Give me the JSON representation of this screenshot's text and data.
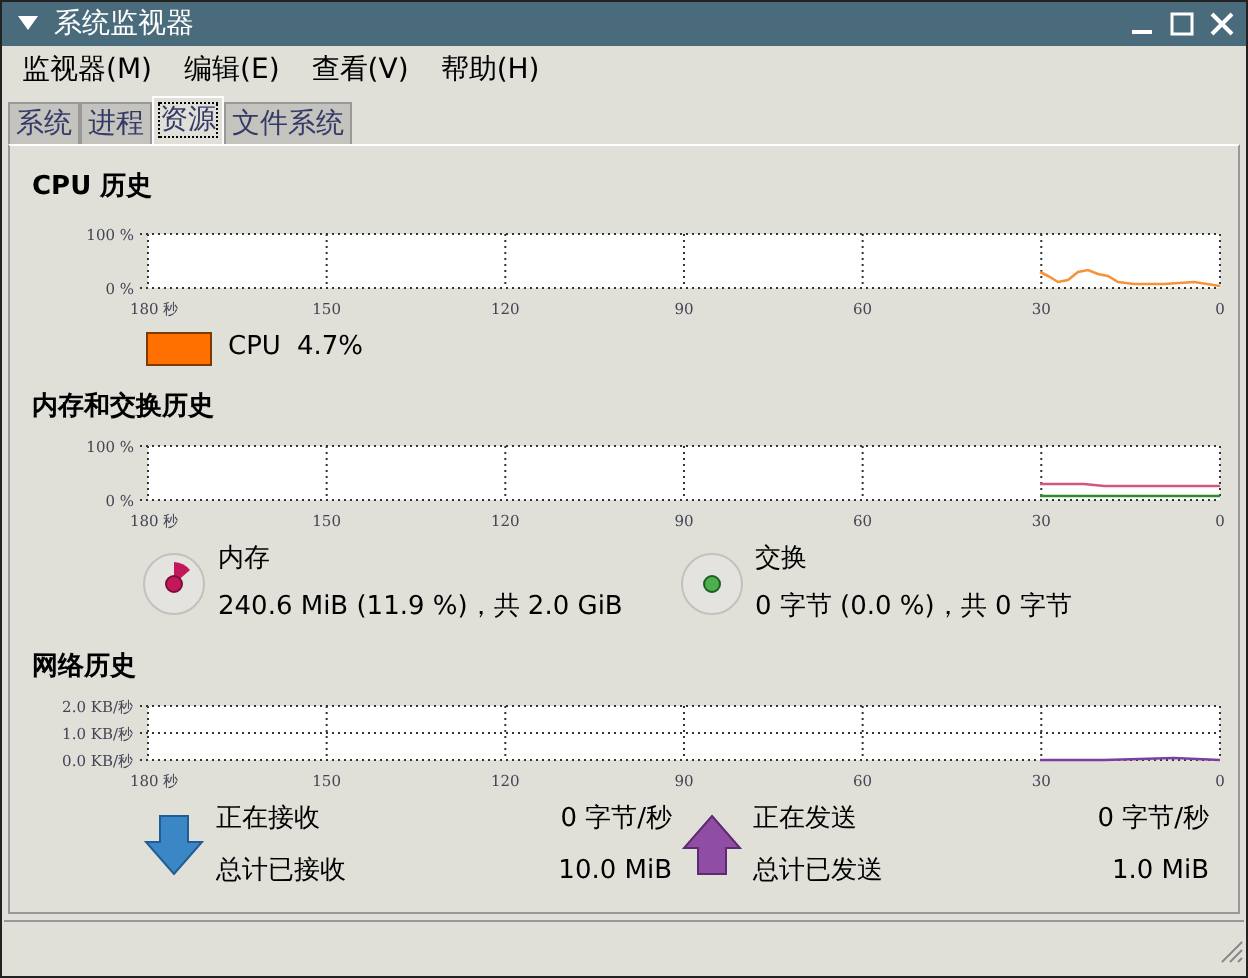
{
  "window": {
    "title": "系统监视器"
  },
  "menu": [
    "监视器(M)",
    "编辑(E)",
    "查看(V)",
    "帮助(H)"
  ],
  "tabs": [
    {
      "label": "系统",
      "selected": false
    },
    {
      "label": "进程",
      "selected": false
    },
    {
      "label": "资源",
      "selected": true
    },
    {
      "label": "文件系统",
      "selected": false
    }
  ],
  "cpu": {
    "title": "CPU 历史",
    "y_labels": [
      "100 %",
      "0 %"
    ],
    "x_labels": [
      "180 秒",
      "150",
      "120",
      "90",
      "60",
      "30",
      "0"
    ],
    "legend": [
      {
        "label": "CPU",
        "value": "4.7%",
        "color": "#ff7000"
      }
    ]
  },
  "memory": {
    "title": "内存和交换历史",
    "y_labels": [
      "100 %",
      "0 %"
    ],
    "x_labels": [
      "180 秒",
      "150",
      "120",
      "90",
      "60",
      "30",
      "0"
    ],
    "items": [
      {
        "kind": "memory",
        "label": "内存",
        "value": "240.6 MiB (11.9 %)，共 2.0 GiB",
        "color": "#c2185b"
      },
      {
        "kind": "swap",
        "label": "交换",
        "value": "0 字节 (0.0 %)，共 0 字节",
        "color": "#4caf50"
      }
    ]
  },
  "network": {
    "title": "网络历史",
    "y_labels": [
      "2.0 KB/秒",
      "1.0 KB/秒",
      "0.0 KB/秒"
    ],
    "x_labels": [
      "180 秒",
      "150",
      "120",
      "90",
      "60",
      "30",
      "0"
    ],
    "items": [
      {
        "kind": "receive",
        "rate_label": "正在接收",
        "rate": "0 字节/秒",
        "total_label": "总计已接收",
        "total": "10.0 MiB"
      },
      {
        "kind": "send",
        "rate_label": "正在发送",
        "rate": "0 字节/秒",
        "total_label": "总计已发送",
        "total": "1.0 MiB"
      }
    ]
  }
}
